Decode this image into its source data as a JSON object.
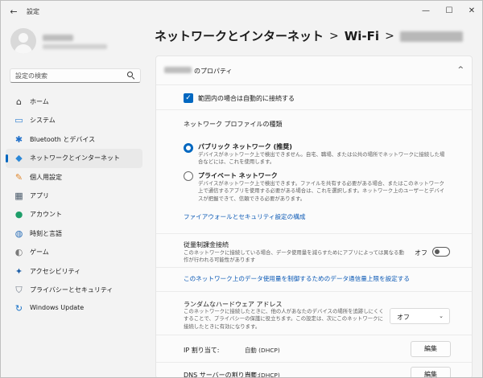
{
  "window": {
    "title": "設定",
    "back_icon": "←",
    "minimize_icon": "—",
    "maximize_icon": "☐",
    "close_icon": "✕"
  },
  "sidebar": {
    "search_placeholder": "設定の検索",
    "items": [
      {
        "label": "ホーム",
        "icon": "home-icon",
        "glyph": "⌂",
        "color": "#333333"
      },
      {
        "label": "システム",
        "icon": "system-icon",
        "glyph": "▭",
        "color": "#2f7fd0"
      },
      {
        "label": "Bluetooth とデバイス",
        "icon": "bluetooth-icon",
        "glyph": "✱",
        "color": "#1f6fc9"
      },
      {
        "label": "ネットワークとインターネット",
        "icon": "network-icon",
        "glyph": "◆",
        "color": "#2b88d8",
        "active": true
      },
      {
        "label": "個人用設定",
        "icon": "personalization-icon",
        "glyph": "✎",
        "color": "#e0872e"
      },
      {
        "label": "アプリ",
        "icon": "apps-icon",
        "glyph": "▦",
        "color": "#4a5a6a"
      },
      {
        "label": "アカウント",
        "icon": "account-icon",
        "glyph": "●",
        "color": "#1e9e6a"
      },
      {
        "label": "時刻と言語",
        "icon": "time-language-icon",
        "glyph": "◍",
        "color": "#2b6fb8"
      },
      {
        "label": "ゲーム",
        "icon": "gaming-icon",
        "glyph": "◐",
        "color": "#7a7a7a"
      },
      {
        "label": "アクセシビリティ",
        "icon": "accessibility-icon",
        "glyph": "✦",
        "color": "#2060a8"
      },
      {
        "label": "プライバシーとセキュリティ",
        "icon": "shield-icon",
        "glyph": "⛉",
        "color": "#6d7785"
      },
      {
        "label": "Windows Update",
        "icon": "windows-update-icon",
        "glyph": "↻",
        "color": "#1a73c8"
      }
    ]
  },
  "breadcrumb": {
    "part1": "ネットワークとインターネット",
    "sep": ">",
    "part2": "Wi-Fi"
  },
  "panel": {
    "header_label": "のプロパティ",
    "collapse_glyph": "^",
    "auto_connect": {
      "label": "範囲内の場合は自動的に接続する",
      "checked": true
    },
    "profile_section_title": "ネットワーク プロファイルの種類",
    "public": {
      "title": "パブリック ネットワーク (推奨)",
      "desc": "デバイスがネットワーク上で検出できません。自宅、職場、または公共の場所でネットワークに接続した場合などには、これを使用します。",
      "selected": true
    },
    "private": {
      "title": "プライベート ネットワーク",
      "desc": "デバイスがネットワーク上で検出できます。ファイルを共有する必要がある場合、またはこのネットワーク上で通信するアプリを使用する必要がある場合は、これを選択します。ネットワーク上のユーザーとデバイスが把握できて、信頼できる必要があります。",
      "selected": false
    },
    "firewall_link": "ファイアウォールとセキュリティ設定の構成",
    "metered": {
      "title": "従量制課金接続",
      "desc": "このネットワークに接続している場合、データ使用量を減らすためにアプリによっては異なる動作が行われる可能性があります",
      "state_label": "オフ"
    },
    "data_limit_link": "このネットワーク上のデータ使用量を制御するためのデータ通信量上限を設定する",
    "random_hw": {
      "title": "ランダムなハードウェア アドレス",
      "desc": "このネットワークに接続したときに、他の人があなたのデバイスの場所を追跡しにくくすることで、プライバシーの保護に役立ちます。この設定は、次にこのネットワークに接続したときに有効になります。",
      "value": "オフ"
    },
    "ip": {
      "label": "IP 割り当て:",
      "value": "自動 (DHCP)",
      "button": "編集"
    },
    "dns": {
      "label": "DNS サーバーの割り当て:",
      "value": "自動 (DHCP)",
      "button": "編集"
    }
  }
}
